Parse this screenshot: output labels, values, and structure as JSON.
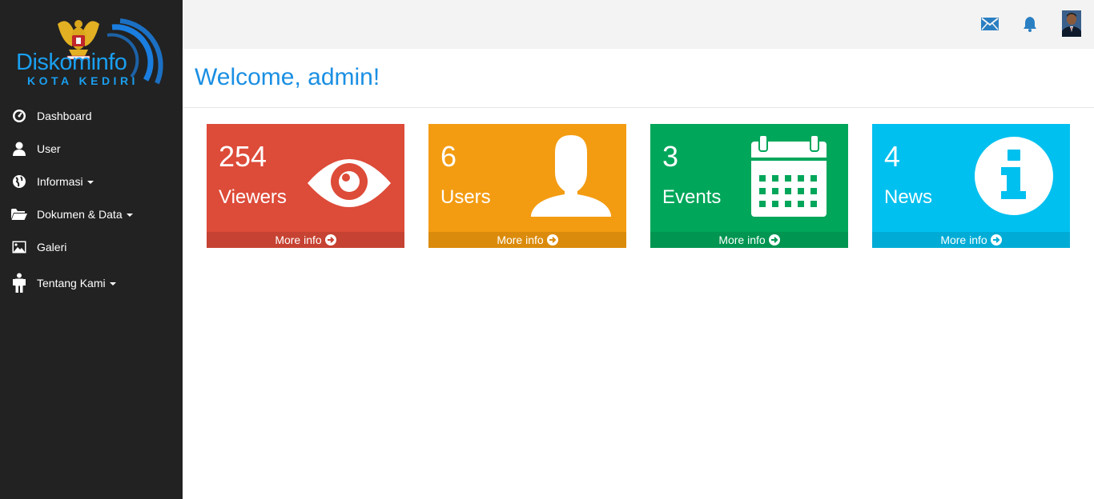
{
  "brand": {
    "name": "Diskominfo",
    "subtitle": "KOTA KEDIRI",
    "color": "#1a9ff0"
  },
  "sidebar": {
    "items": [
      {
        "label": "Dashboard",
        "icon": "dashboard-icon"
      },
      {
        "label": "User",
        "icon": "user-icon"
      },
      {
        "label": "Informasi",
        "icon": "globe-icon",
        "dropdown": true
      },
      {
        "label": "Dokumen & Data",
        "icon": "folder-open-icon",
        "dropdown": true
      },
      {
        "label": "Galeri",
        "icon": "picture-icon"
      },
      {
        "label": "Tentang Kami",
        "icon": "person-icon",
        "dropdown": true
      }
    ]
  },
  "topbar": {
    "icons": [
      "mail-icon",
      "bell-icon",
      "avatar"
    ],
    "accent": "#2a7fc2"
  },
  "main": {
    "title": "Welcome, admin!",
    "title_color": "#1a8fe3",
    "cards": [
      {
        "count": "254",
        "label": "Viewers",
        "footer": "More info",
        "icon": "eye-icon",
        "color": "#dd4b39"
      },
      {
        "count": "6",
        "label": "Users",
        "footer": "More info",
        "icon": "user-silhouette-icon",
        "color": "#f39c12"
      },
      {
        "count": "3",
        "label": "Events",
        "footer": "More info",
        "icon": "calendar-icon",
        "color": "#00a65a"
      },
      {
        "count": "4",
        "label": "News",
        "footer": "More info",
        "icon": "info-circle-icon",
        "color": "#00c0ef"
      }
    ]
  }
}
